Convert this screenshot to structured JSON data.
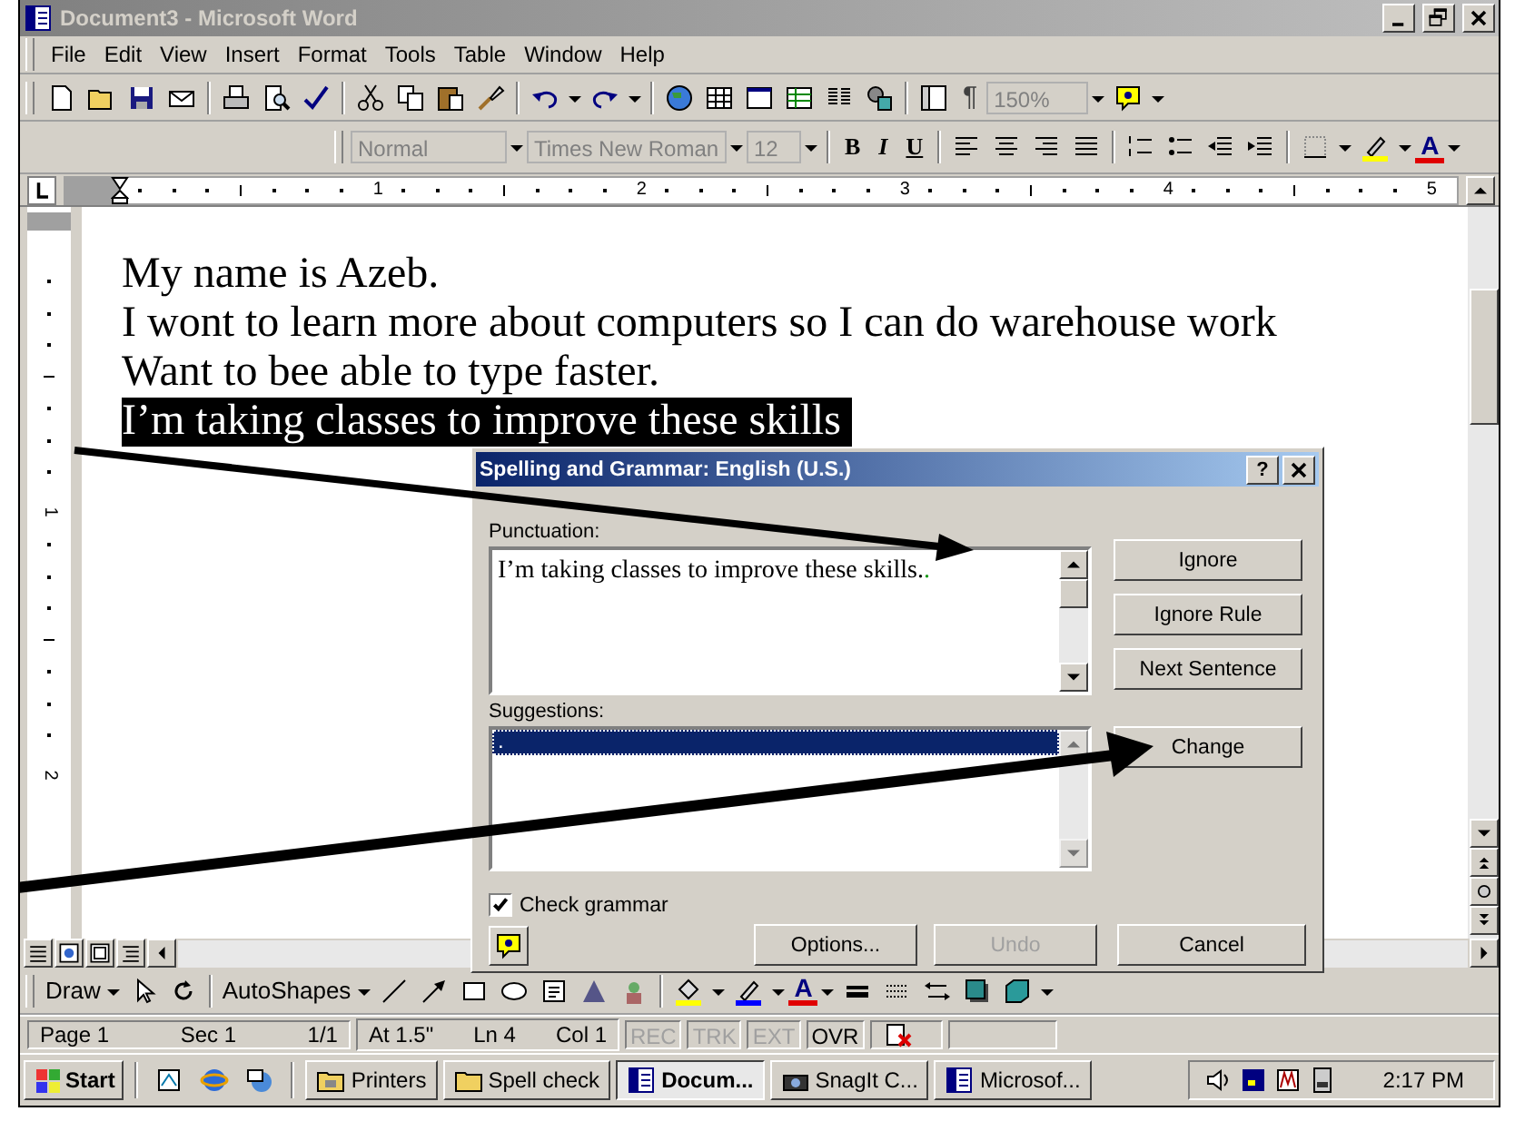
{
  "window": {
    "title": "Document3 - Microsoft Word"
  },
  "menu": [
    "File",
    "Edit",
    "View",
    "Insert",
    "Format",
    "Tools",
    "Table",
    "Window",
    "Help"
  ],
  "standard_toolbar": {
    "show_marks": "¶",
    "zoom": "150%"
  },
  "formatting_toolbar": {
    "style": "Normal",
    "font": "Times New Roman",
    "size": "12",
    "bold": "B",
    "italic": "I",
    "underline": "U",
    "font_color": "A"
  },
  "ruler": {
    "horizontal_numbers": [
      "1",
      "2",
      "3",
      "4",
      "5"
    ],
    "vertical_numbers": [
      "1",
      "2"
    ]
  },
  "document": {
    "lines": [
      {
        "text": "My name is Azeb.",
        "selected": false
      },
      {
        "text": "I wont to learn more about computers so I can do warehouse work",
        "selected": false
      },
      {
        "text": "Want to bee able to type faster.",
        "selected": false
      },
      {
        "text": "I’m taking classes to improve these skills",
        "selected": true
      }
    ]
  },
  "dialog": {
    "title": "Spelling and Grammar: English (U.S.)",
    "help": "?",
    "problem_label": "Punctuation:",
    "sentence": "I’m taking classes to improve these skills.",
    "error_mark": ".",
    "suggestions_label": "Suggestions:",
    "suggestions": [
      {
        "text": ".",
        "selected": true
      }
    ],
    "side_buttons": [
      {
        "label": "Ignore",
        "disabled": false
      },
      {
        "label": "Ignore Rule",
        "disabled": false
      },
      {
        "label": "Next Sentence",
        "disabled": false
      },
      {
        "label": "Change",
        "disabled": false
      }
    ],
    "check_grammar": {
      "label": "Check grammar",
      "checked": true
    },
    "bottom_buttons": [
      {
        "label": "Options...",
        "disabled": false
      },
      {
        "label": "Undo",
        "disabled": true
      },
      {
        "label": "Cancel",
        "disabled": false
      }
    ]
  },
  "drawing_toolbar": {
    "draw": "Draw",
    "autoshapes": "AutoShapes",
    "font_color": "A"
  },
  "status_bar": {
    "position": [
      "Page 1",
      "Sec 1",
      "1/1"
    ],
    "cursor": [
      "At 1.5\"",
      "Ln 4",
      "Col 1"
    ],
    "indicators": [
      {
        "label": "REC",
        "active": false
      },
      {
        "label": "TRK",
        "active": false
      },
      {
        "label": "EXT",
        "active": false
      },
      {
        "label": "OVR",
        "active": true
      }
    ]
  },
  "taskbar": {
    "start": "Start",
    "tasks": [
      {
        "label": "Printers",
        "selected": false
      },
      {
        "label": "Spell check",
        "selected": false
      },
      {
        "label": "Docum...",
        "selected": true
      },
      {
        "label": "SnagIt C...",
        "selected": false
      },
      {
        "label": "Microsof...",
        "selected": false
      }
    ],
    "clock": "2:17 PM"
  }
}
